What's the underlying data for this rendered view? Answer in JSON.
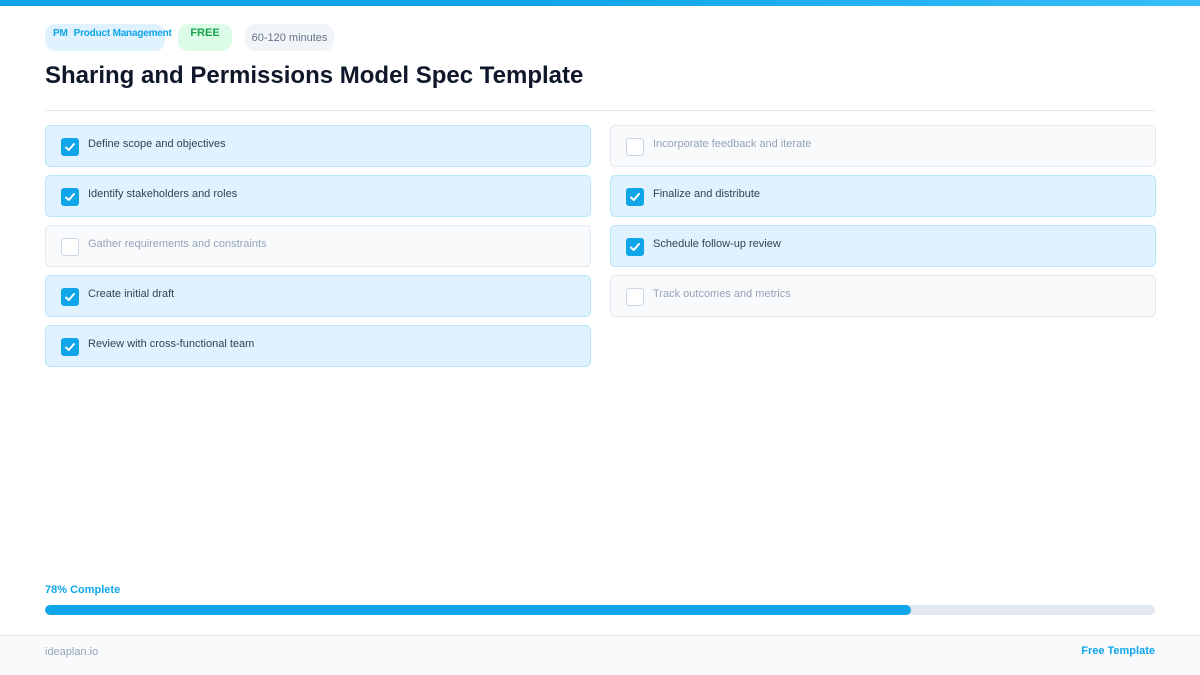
{
  "badges": {
    "category_abbr": "PM",
    "category_name": "Product Management",
    "price": "FREE",
    "duration": "60-120 minutes"
  },
  "title": "Sharing and Permissions Model Spec Template",
  "tasks_left": [
    {
      "label": "Define scope and objectives",
      "checked": true
    },
    {
      "label": "Identify stakeholders and roles",
      "checked": true
    },
    {
      "label": "Gather requirements and constraints",
      "checked": false
    },
    {
      "label": "Create initial draft",
      "checked": true
    },
    {
      "label": "Review with cross-functional team",
      "checked": true
    }
  ],
  "tasks_right": [
    {
      "label": "Incorporate feedback and iterate",
      "checked": false
    },
    {
      "label": "Finalize and distribute",
      "checked": true
    },
    {
      "label": "Schedule follow-up review",
      "checked": true
    },
    {
      "label": "Track outcomes and metrics",
      "checked": false
    }
  ],
  "progress": {
    "label": "78% Complete",
    "percent": 78
  },
  "footer": {
    "brand": "ideaplan.io",
    "cta": "Free Template"
  },
  "colors": {
    "accent": "#0ea5e9",
    "free_badge": "#16a34a",
    "title": "#0f172a"
  }
}
